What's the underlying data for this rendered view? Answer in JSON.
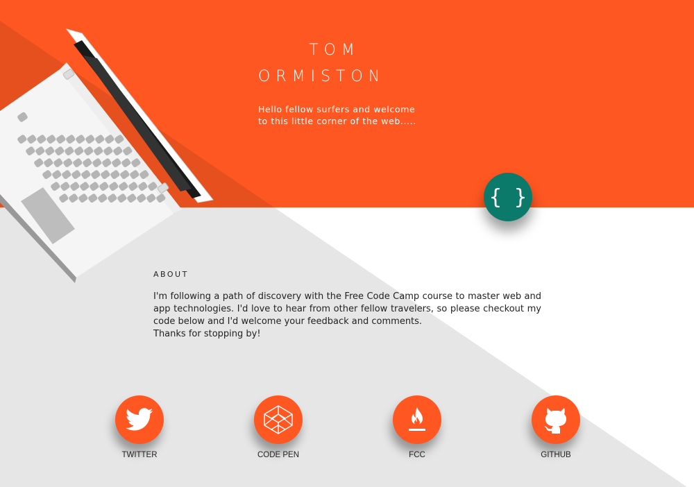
{
  "colors": {
    "accent": "#ff5722",
    "accent_dark": "#e6501f",
    "teal": "#0c7a6b",
    "light_gray": "#e6e6e6"
  },
  "header": {
    "first_name": "TOM",
    "last_name": "ORMISTON",
    "tagline": "Hello fellow surfers and welcome to this little corner of the web....."
  },
  "badge": {
    "icon": "code-braces-icon",
    "symbol": "{ }"
  },
  "about": {
    "heading": "ABOUT",
    "text": "I'm following a path of discovery with the Free Code Camp course to master web and app technologies. I'd love to hear from other fellow travelers, so please checkout my code below and I'd welcome your feedback and comments.",
    "thanks": "Thanks for stopping by!"
  },
  "social": [
    {
      "label": "TWITTER",
      "icon": "twitter-icon"
    },
    {
      "label": "CODE PEN",
      "icon": "codepen-icon"
    },
    {
      "label": "FCC",
      "icon": "fire-icon"
    },
    {
      "label": "GITHUB",
      "icon": "github-icon"
    }
  ]
}
